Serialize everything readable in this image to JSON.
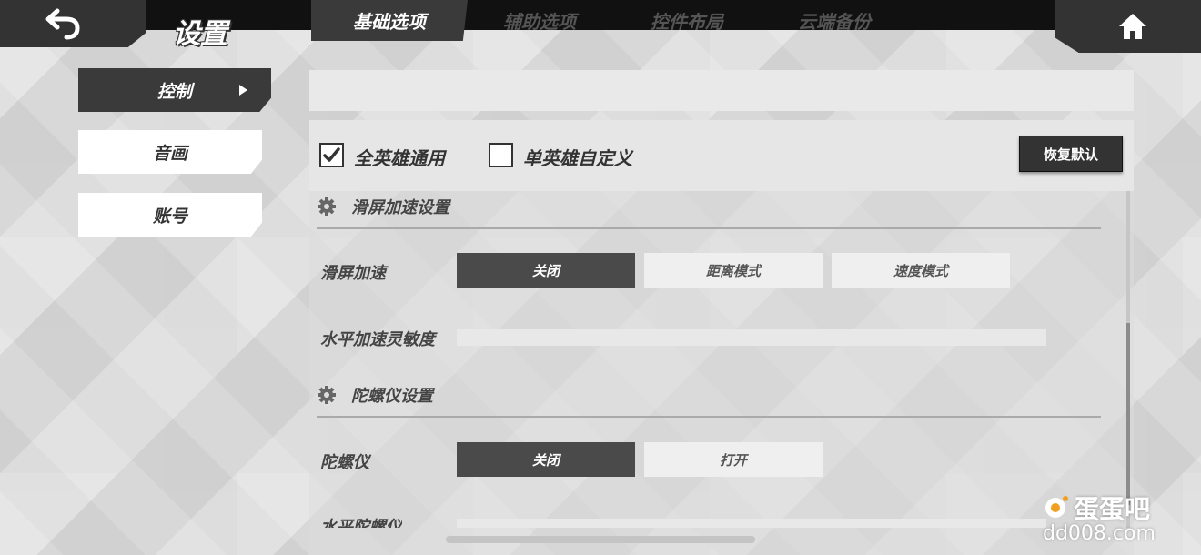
{
  "header": {
    "title": "设置",
    "back_icon": "back-arrow-icon",
    "home_icon": "home-icon"
  },
  "sidebar": {
    "items": [
      {
        "label": "控制",
        "active": true
      },
      {
        "label": "音画",
        "active": false
      },
      {
        "label": "账号",
        "active": false
      }
    ]
  },
  "tabs": [
    {
      "label": "基础选项",
      "active": true
    },
    {
      "label": "辅助选项",
      "active": false
    },
    {
      "label": "控件布局",
      "active": false
    },
    {
      "label": "云端备份",
      "active": false
    }
  ],
  "options": {
    "all_heroes": {
      "label": "全英雄通用",
      "checked": true
    },
    "single_hero": {
      "label": "单英雄自定义",
      "checked": false
    },
    "reset_label": "恢复默认"
  },
  "sections": {
    "swipe": {
      "title": "滑屏加速设置",
      "field_label": "滑屏加速",
      "choices": [
        "关闭",
        "距离模式",
        "速度模式"
      ],
      "selected": "关闭",
      "sensitivity_label": "水平加速灵敏度"
    },
    "gyro": {
      "title": "陀螺仪设置",
      "field_label": "陀螺仪",
      "choices": [
        "关闭",
        "打开"
      ],
      "selected": "关闭",
      "cut_label": "水平陀螺仪"
    }
  },
  "watermark": {
    "name": "蛋蛋吧",
    "url": "dd008.com"
  },
  "colors": {
    "dark": "#3a3a3a",
    "light": "#efefef",
    "background": "#d8d8d8"
  }
}
